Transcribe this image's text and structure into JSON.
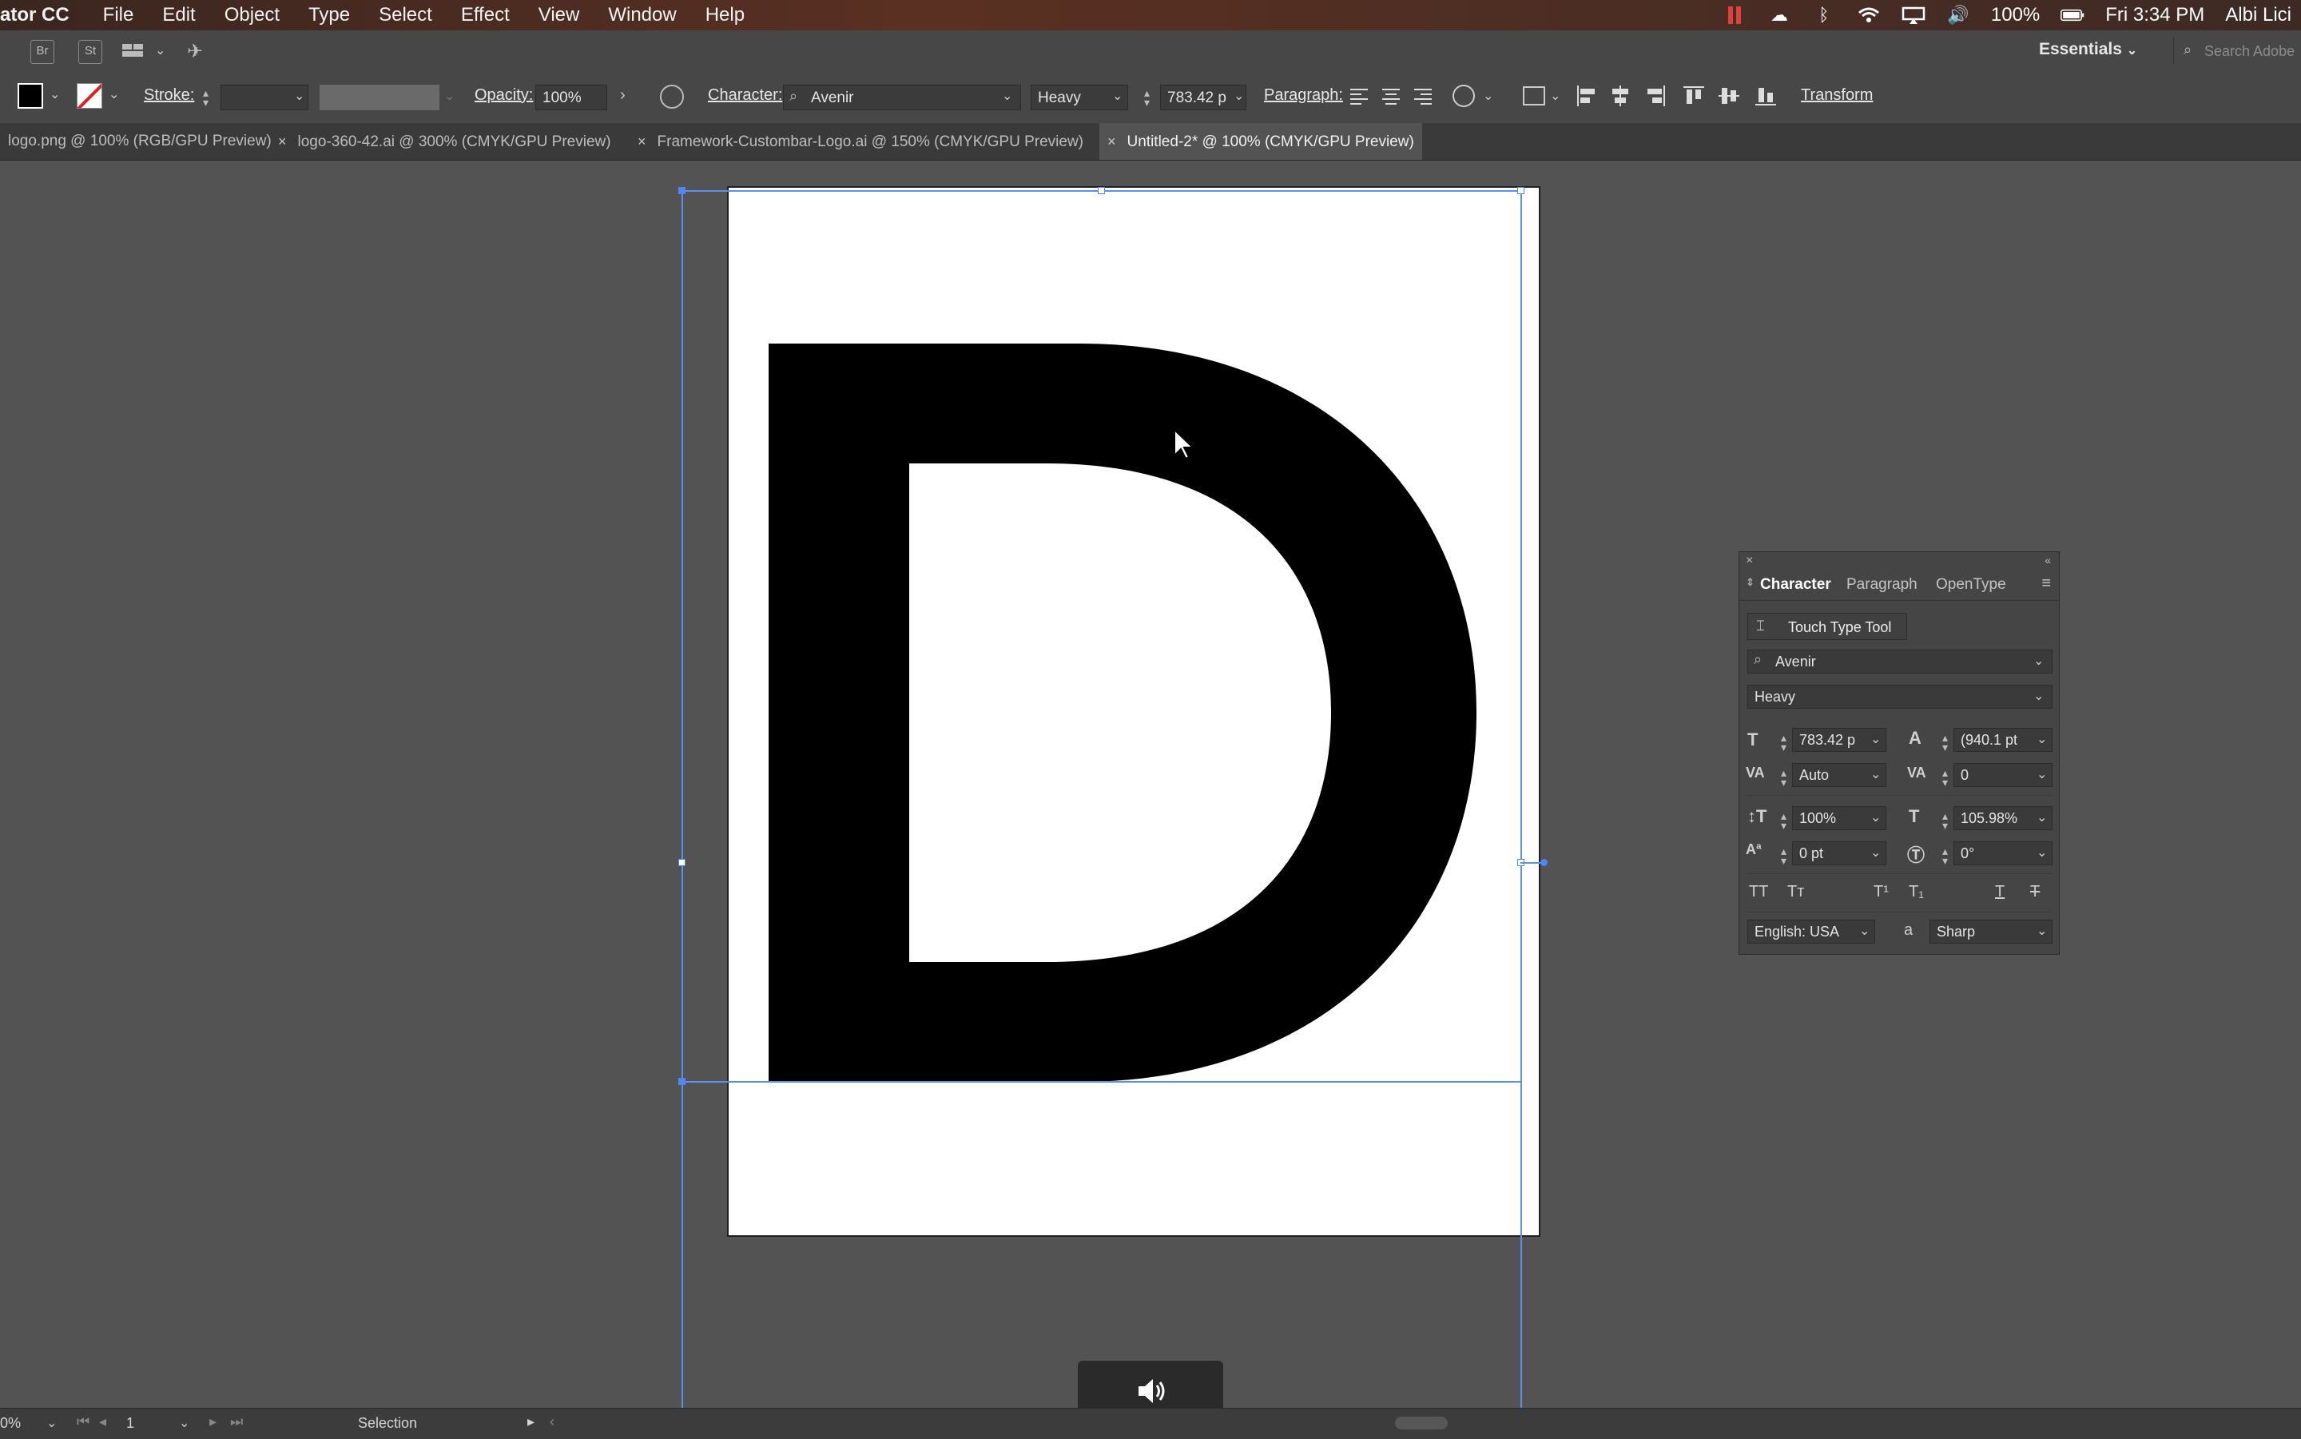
{
  "menubar": {
    "app_name": "ator CC",
    "items": [
      "File",
      "Edit",
      "Object",
      "Type",
      "Select",
      "Effect",
      "View",
      "Window",
      "Help"
    ],
    "battery": "100%",
    "clock": "Fri 3:34 PM",
    "user": "Albi Lici"
  },
  "appbar": {
    "br": "Br",
    "st": "St",
    "workspace": "Essentials",
    "search_placeholder": "Search Adobe"
  },
  "controlbar": {
    "stroke_label": "Stroke:",
    "opacity_label": "Opacity:",
    "opacity_value": "100%",
    "character_label": "Character:",
    "font_family": "Avenir",
    "font_style": "Heavy",
    "font_size": "783.42 p",
    "paragraph_label": "Paragraph:",
    "transform_label": "Transform"
  },
  "tabs": [
    {
      "label": "logo.png @ 100% (RGB/GPU Preview)",
      "active": false
    },
    {
      "label": "logo-360-42.ai @ 300% (CMYK/GPU Preview)",
      "active": false
    },
    {
      "label": "Framework-Custombar-Logo.ai @ 150% (CMYK/GPU Preview)",
      "active": false
    },
    {
      "label": "Untitled-2* @ 100% (CMYK/GPU Preview)",
      "active": true
    }
  ],
  "canvas": {
    "letter": "D"
  },
  "character_panel": {
    "tabs": [
      "Character",
      "Paragraph",
      "OpenType"
    ],
    "touch_type_label": "Touch Type Tool",
    "font_family": "Avenir",
    "font_style": "Heavy",
    "font_size": "783.42 p",
    "leading": "(940.1 pt",
    "kerning": "Auto",
    "tracking": "0",
    "vertical_scale": "100%",
    "horizontal_scale": "105.98%",
    "baseline_shift": "0 pt",
    "rotation": "0°",
    "language": "English: USA",
    "antialias_glyph": "a",
    "antialias": "Sharp"
  },
  "statusbar": {
    "zoom": "0%",
    "page": "1",
    "tool": "Selection"
  },
  "colors": {
    "menubar": "#4a2a22",
    "ui_dark": "#474747",
    "canvas_bg": "#535353",
    "guide": "#5b8ff0"
  }
}
